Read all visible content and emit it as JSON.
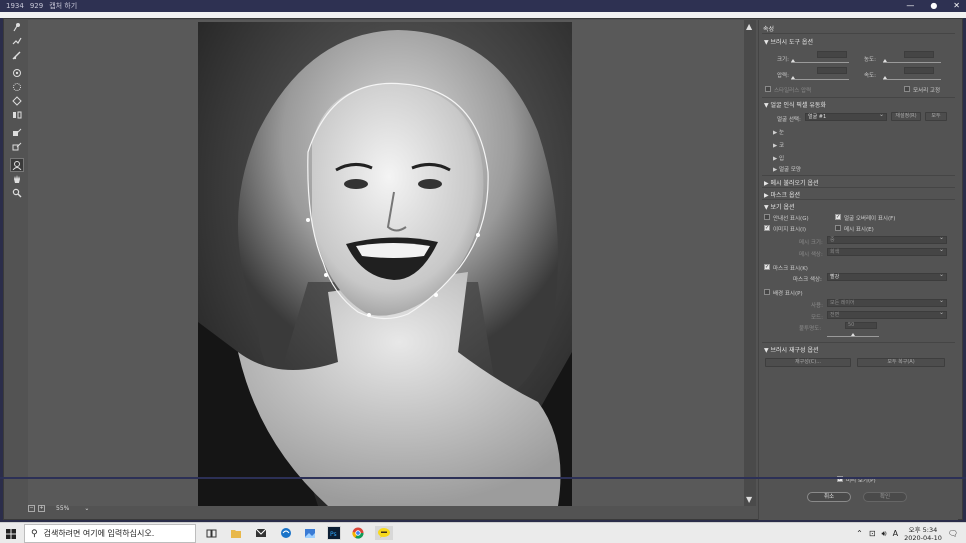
{
  "titlebar": {
    "width_val": "1934",
    "height_val": "929",
    "mode_label": "캡처 하기"
  },
  "toolbar": {
    "tools": [
      "forward-warp-icon",
      "reconstruct-icon",
      "smooth-icon",
      "twirl-icon",
      "pucker-icon",
      "bloat-icon",
      "push-left-icon",
      "freeze-mask-icon",
      "thaw-mask-icon",
      "face-tool-icon",
      "hand-icon",
      "zoom-icon"
    ]
  },
  "panel": {
    "title": "속성",
    "brush_options": {
      "header": "▼ 브러시 도구 옵션",
      "size_label": "크기:",
      "density_label": "농도:",
      "pressure_label": "압력:",
      "rate_label": "속도:",
      "stylus_label": "스타일러스 압력",
      "pin_edges_label": "모서리 고정"
    },
    "face_aware": {
      "header": "▼ 얼굴 인식 픽셀 유동화",
      "select_face_label": "얼굴 선택:",
      "select_face_value": "얼굴 #1",
      "reset_label": "재설정(R)",
      "all_label": "모두",
      "sub_eyes": "▶ 눈",
      "sub_nose": "▶ 코",
      "sub_mouth": "▶ 입",
      "sub_face_shape": "▶ 얼굴 모양"
    },
    "mesh_header": "▶ 메시 불러오기 옵션",
    "mask_header": "▶ 마스크 옵션",
    "view_options": {
      "header": "▼ 보기 옵션",
      "show_guides": "안내선 표시(G)",
      "show_face_overlay": "얼굴 오버레이 표시(F)",
      "show_image": "이미지 표시(I)",
      "show_mesh": "메시 표시(E)",
      "mesh_size_label": "메시 크기:",
      "mesh_size_value": "중",
      "mesh_color_label": "메시 색상:",
      "mesh_color_value": "회색",
      "show_mask": "마스크 표시(K)",
      "mask_color_label": "마스크 색상:",
      "mask_color_value": "빨강",
      "show_backdrop": "배경 표시(P)",
      "use_label": "사용:",
      "use_value": "모든 레이어",
      "mode_label": "모드:",
      "mode_value": "전면",
      "opacity_label": "불투명도:",
      "opacity_value": "50"
    },
    "brush_reconstruct": {
      "header": "▼ 브러시 재구성 옵션",
      "reconstruct_btn": "재구성(C)...",
      "restore_all_btn": "모두 복구(A)"
    },
    "preview_label": "미리 보기(P)",
    "cancel_btn": "취소",
    "ok_btn": "확인"
  },
  "status": {
    "zoom": "55%"
  },
  "taskbar": {
    "search_placeholder": "검색하려면 여기에 입력하십시오.",
    "time": "오후 5:34",
    "date": "2020-04-10",
    "ime": "A"
  },
  "colors": {
    "workspace": "#535353",
    "panel": "#535353",
    "taskbar": "#ebebeb",
    "titlebar": "#2e3152"
  }
}
